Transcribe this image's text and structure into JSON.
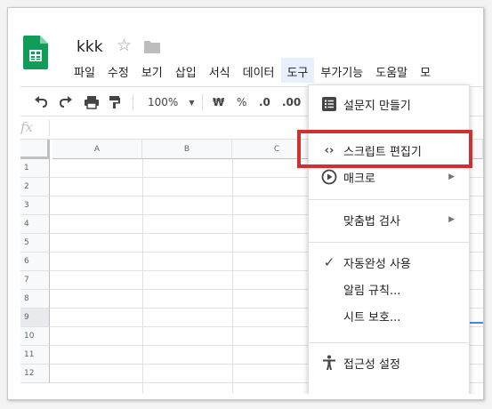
{
  "document": {
    "title": "kkk"
  },
  "menubar": {
    "items": [
      {
        "label": "파일"
      },
      {
        "label": "수정"
      },
      {
        "label": "보기"
      },
      {
        "label": "삽입"
      },
      {
        "label": "서식"
      },
      {
        "label": "데이터"
      },
      {
        "label": "도구"
      },
      {
        "label": "부가기능"
      },
      {
        "label": "도움말"
      },
      {
        "label": "모"
      }
    ]
  },
  "toolbar": {
    "zoom": "100%",
    "currency": "₩",
    "percent": "%",
    "decrease_decimals": ".0",
    "increase_decimals": ".00"
  },
  "formula_bar": {
    "fx_label": "fx"
  },
  "grid": {
    "columns": [
      "A",
      "B",
      "C"
    ],
    "rows": [
      "1",
      "2",
      "3",
      "4",
      "5",
      "6",
      "7",
      "8",
      "9",
      "10",
      "11",
      "12"
    ],
    "selected_row": "9"
  },
  "tools_menu": {
    "create_form": "설문지 만들기",
    "script_editor": "스크립트 편집기",
    "macros": "매크로",
    "spelling": "맞춤법 검사",
    "autocomplete": "자동완성 사용",
    "notification_rules": "알림 규칙...",
    "protect_sheet": "시트 보호...",
    "accessibility": "접근성 설정"
  },
  "colors": {
    "highlight": "#d32f2f",
    "sheets_green": "#0f9d58",
    "selection_blue": "#4a86e8"
  }
}
